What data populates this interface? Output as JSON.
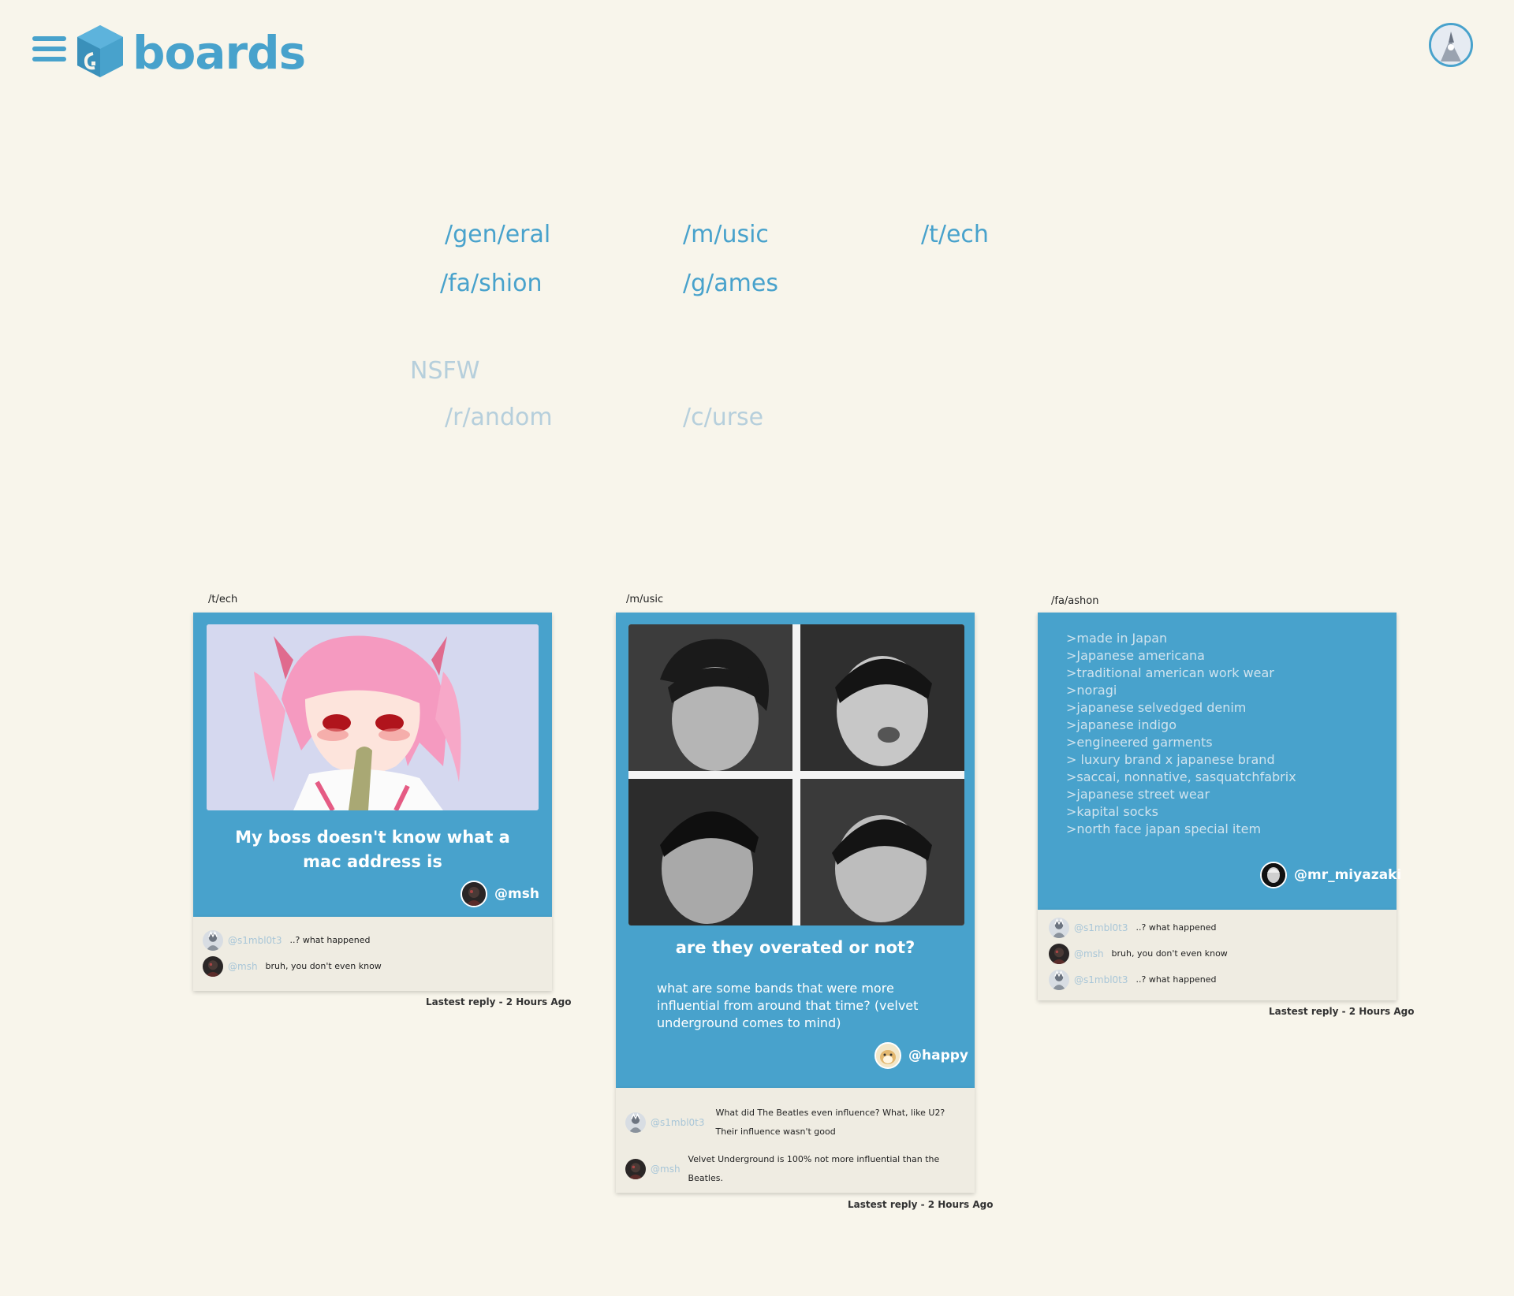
{
  "header": {
    "logo_text": "boards",
    "menu_icon": "hamburger-menu-icon",
    "logo_icon": "cube-logo-icon"
  },
  "boards": {
    "sfw": [
      "/gen/eral",
      "/m/usic",
      "/t/ech",
      "/fa/shion",
      "/g/ames"
    ],
    "nsfw_heading": "NSFW",
    "nsfw": [
      "/r/andom",
      "/c/urse"
    ]
  },
  "colors": {
    "background": "#f8f5eb",
    "accent": "#48a2cc",
    "faded_link": "#b6cfdc",
    "reply_panel": "#efece2"
  },
  "posts": [
    {
      "board": "/t/ech",
      "title": "My boss doesn't know what a mac address is",
      "author": "@msh",
      "replies": [
        {
          "user": "@s1mbl0t3",
          "text": "..? what happened"
        },
        {
          "user": "@msh",
          "text": "bruh, you don't even know"
        }
      ],
      "latest": "Lastest reply - 2 Hours Ago"
    },
    {
      "board": "/m/usic",
      "title": "are they overated or not?",
      "body": "what are some bands that were more influential from around that time? (velvet underground comes to mind)",
      "author": "@happy",
      "replies": [
        {
          "user": "@s1mbl0t3",
          "text": "What did The Beatles even influence? What, like U2?",
          "text2": "Their influence wasn't good"
        },
        {
          "user": "@msh",
          "text": "Velvet Underground is 100% not more influential than the Beatles."
        }
      ],
      "latest": "Lastest reply - 2 Hours Ago"
    },
    {
      "board": "/fa/ashon",
      "lines": [
        ">made in Japan",
        ">Japanese americana",
        ">traditional american work wear",
        ">noragi",
        ">japanese selvedged denim",
        ">japanese indigo",
        ">engineered garments",
        "> luxury brand x japanese brand",
        ">saccai, nonnative, sasquatchfabrix",
        ">japanese street wear",
        ">kapital socks",
        ">north face japan special item"
      ],
      "author": "@mr_miyazaki",
      "replies": [
        {
          "user": "@s1mbl0t3",
          "text": "..? what happened"
        },
        {
          "user": "@msh",
          "text": "bruh, you don't even know"
        },
        {
          "user": "@s1mbl0t3",
          "text": "..? what happened"
        }
      ],
      "latest": "Lastest reply - 2 Hours Ago"
    }
  ]
}
